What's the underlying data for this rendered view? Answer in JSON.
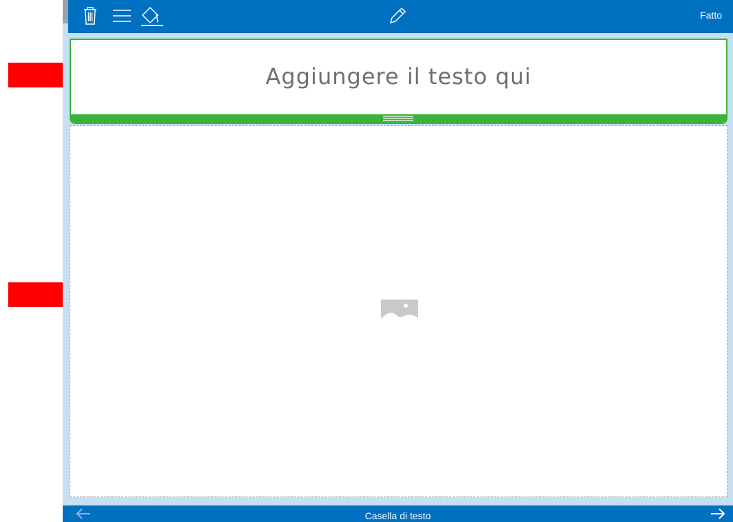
{
  "toolbar": {
    "done_label": "Fatto",
    "icons": [
      "trash-icon",
      "menu-icon",
      "paint-bucket-icon",
      "pencil-icon"
    ]
  },
  "text_box": {
    "placeholder": "Aggiungere il testo qui"
  },
  "image_box": {
    "icon": "image-placeholder-icon"
  },
  "bottom_bar": {
    "title": "Casella di testo",
    "icons": [
      "arrow-left-icon",
      "arrow-right-icon"
    ]
  },
  "annotations": {
    "arrow_color": "#ff0000"
  },
  "colors": {
    "toolbar": "#0070c0",
    "selection": "#3cb33a",
    "frame": "#c6dff2"
  }
}
